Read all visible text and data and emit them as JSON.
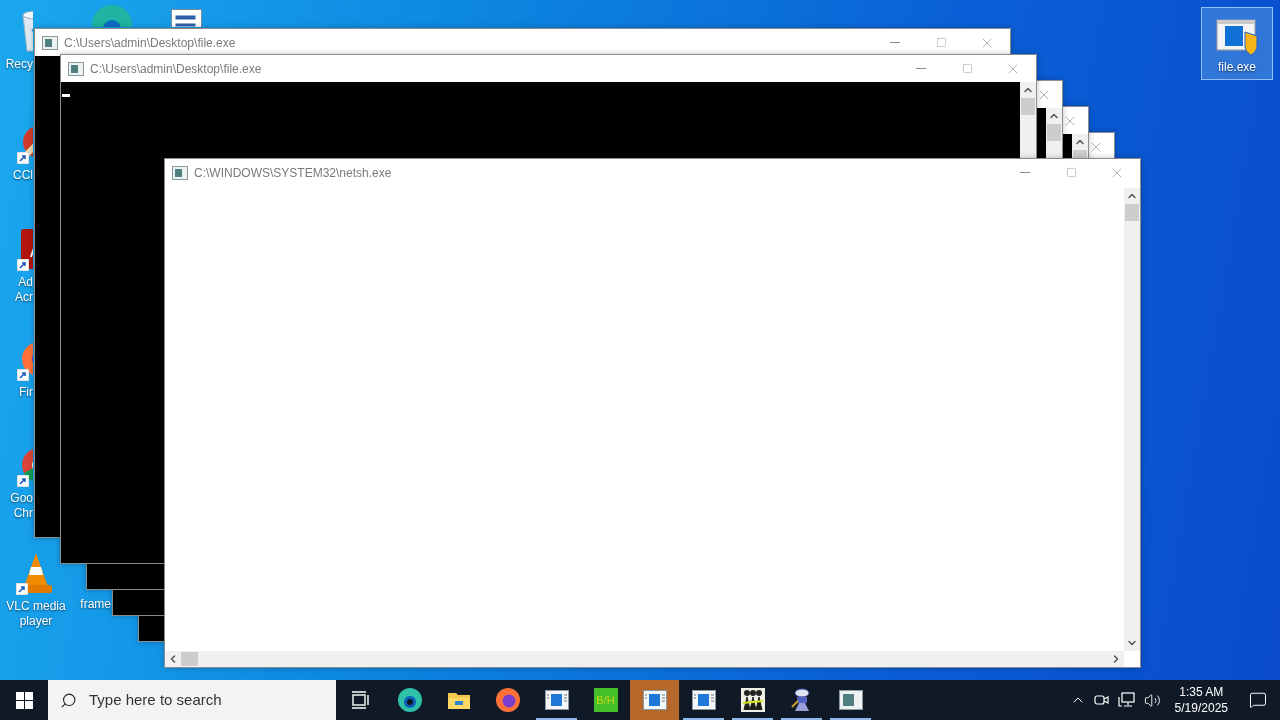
{
  "desktop": {
    "icons": [
      {
        "kind": "recycle-bin",
        "label": [
          "Recy"
        ],
        "shortcut": false,
        "selected": false
      },
      {
        "kind": "ccleaner",
        "label": [
          "CCl"
        ],
        "shortcut": true,
        "selected": false
      },
      {
        "kind": "acrobat",
        "label": [
          "Ad",
          "Acr"
        ],
        "shortcut": true,
        "selected": false
      },
      {
        "kind": "firefox",
        "label": [
          "Fir"
        ],
        "shortcut": true,
        "selected": false
      },
      {
        "kind": "chrome",
        "label": [
          "Goo",
          "Chr"
        ],
        "shortcut": true,
        "selected": false
      },
      {
        "kind": "vlc",
        "label": [
          "VLC media",
          "player"
        ],
        "shortcut": true,
        "selected": false
      },
      {
        "kind": "edge",
        "selected": false
      },
      {
        "kind": "document",
        "selected": false
      },
      {
        "kind": "hidden",
        "label": [
          "frame"
        ],
        "selected": false
      },
      {
        "kind": "application",
        "label": [
          "file.exe"
        ],
        "shortcut": false,
        "selected": true
      }
    ]
  },
  "windows": [
    {
      "kind": "console",
      "title": "C:\\Users\\admin\\Desktop\\file.exe"
    },
    {
      "kind": "console",
      "title": "C:\\Users\\admin\\Desktop\\file.exe",
      "cursor": true
    },
    {
      "kind": "console"
    },
    {
      "kind": "console"
    },
    {
      "kind": "console"
    },
    {
      "kind": "netsh",
      "title": "C:\\WINDOWS\\SYSTEM32\\netsh.exe"
    }
  ],
  "taskbar": {
    "search": {
      "placeholder": "Type here to search"
    },
    "apps": [
      {
        "kind": "task-view",
        "selected": false,
        "running": false
      },
      {
        "kind": "edge",
        "selected": false,
        "running": false
      },
      {
        "kind": "explorer",
        "selected": false,
        "running": false
      },
      {
        "kind": "firefox",
        "selected": false,
        "running": false
      },
      {
        "kind": "app-window",
        "selected": false,
        "running": true
      },
      {
        "kind": "bh",
        "label": "B/H",
        "selected": false,
        "running": false
      },
      {
        "kind": "app-window",
        "selected": true,
        "running": false
      },
      {
        "kind": "app-window",
        "selected": false,
        "running": true
      },
      {
        "kind": "figures",
        "selected": false,
        "running": true
      },
      {
        "kind": "tool",
        "selected": false,
        "running": true
      },
      {
        "kind": "console-app",
        "selected": false,
        "running": true
      }
    ],
    "tray": {
      "time": "1:35 AM",
      "date": "5/19/2025"
    }
  }
}
